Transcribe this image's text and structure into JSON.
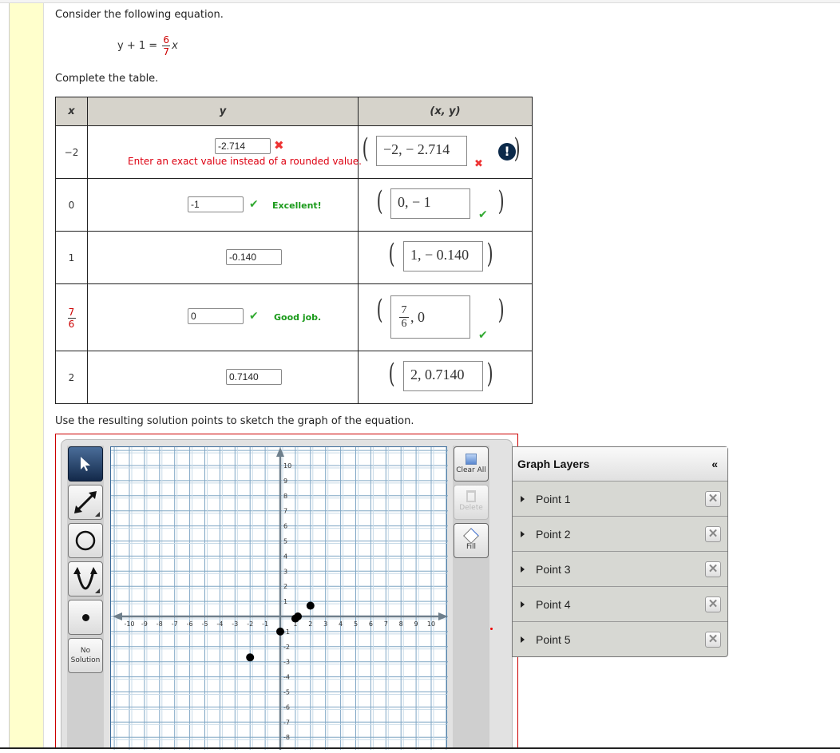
{
  "prompt": {
    "consider": "Consider the following equation.",
    "equation": {
      "lhs": "y + 1 =",
      "frac_num": "6",
      "frac_den": "7",
      "rhs_var": "x"
    },
    "complete": "Complete the table.",
    "use_points": "Use the resulting solution points to sketch the graph of the equation."
  },
  "table": {
    "headers": {
      "x": "x",
      "y": "y",
      "xy": "(x, y)"
    },
    "rows": [
      {
        "x": "−2",
        "y_value": "-2.714",
        "y_status": "wrong",
        "y_feedback": "Enter an exact value instead of a rounded value.",
        "point": "−2, − 2.714",
        "point_status": "wrong",
        "point_alert": "!"
      },
      {
        "x": "0",
        "y_value": "-1",
        "y_status": "correct",
        "y_feedback": "Excellent!",
        "point": "0, − 1",
        "point_status": "correct"
      },
      {
        "x": "1",
        "y_value": "-0.140",
        "y_status": "none",
        "point": "1, − 0.140",
        "point_status": "none"
      },
      {
        "x_num": "7",
        "x_den": "6",
        "y_value": "0",
        "y_status": "correct",
        "y_feedback": "Good job.",
        "point_num": "7",
        "point_den": "6",
        "point_rest": ", 0",
        "point_status": "correct"
      },
      {
        "x": "2",
        "y_value": "0.7140",
        "y_status": "none",
        "point": "2, 0.7140",
        "point_status": "none"
      }
    ]
  },
  "graph": {
    "tools": [
      "select-tool",
      "line-tool",
      "circle-tool",
      "parabola-tool",
      "point-tool"
    ],
    "no_solution_label_1": "No",
    "no_solution_label_2": "Solution",
    "right_buttons": {
      "clear_all": "Clear All",
      "delete": "Delete",
      "fill": "Fill"
    },
    "layers_title": "Graph Layers",
    "collapse_glyph": "«",
    "layers": [
      "Point 1",
      "Point 2",
      "Point 3",
      "Point 4",
      "Point 5"
    ],
    "x_ticks": [
      "-10",
      "-9",
      "-8",
      "-7",
      "-6",
      "-5",
      "-4",
      "-3",
      "-2",
      "-1",
      "1",
      "2",
      "3",
      "4",
      "5",
      "6",
      "7",
      "8",
      "9",
      "10"
    ],
    "y_ticks": [
      "10",
      "9",
      "8",
      "7",
      "6",
      "5",
      "4",
      "3",
      "2",
      "1",
      "-1",
      "-2",
      "-3",
      "-4",
      "-5",
      "-6",
      "-7",
      "-8"
    ],
    "points": [
      {
        "x": -2,
        "y": -2.714
      },
      {
        "x": 0,
        "y": -1
      },
      {
        "x": 1,
        "y": -0.14
      },
      {
        "x": 1.1667,
        "y": 0
      },
      {
        "x": 2,
        "y": 0.714
      }
    ]
  }
}
